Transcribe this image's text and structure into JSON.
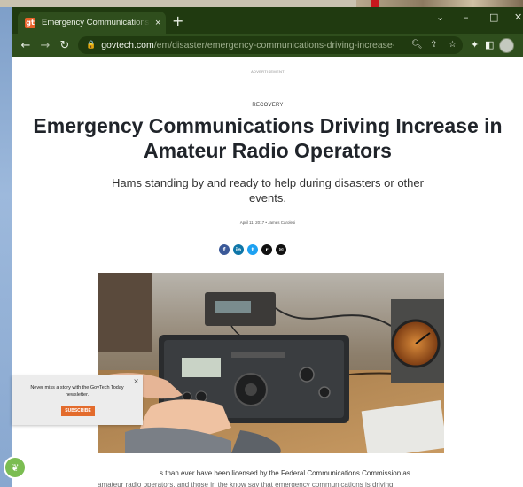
{
  "browser": {
    "tab": {
      "favicon_text": "gt",
      "title": "Emergency Communications Driv",
      "close_glyph": "×"
    },
    "new_tab_glyph": "+",
    "window_controls": {
      "collapse": "⌄",
      "minimize": "–",
      "maximize": "□",
      "close": "✕"
    },
    "nav": {
      "back": "←",
      "forward": "→",
      "reload": "↻"
    },
    "address": {
      "domain": "govtech.com",
      "path": "/em/disaster/emergency-communications-driving-increase-in..."
    }
  },
  "article": {
    "advertisement_label": "ADVERTISEMENT",
    "category": "RECOVERY",
    "headline": "Emergency Communications Driving Increase in Amateur Radio Operators",
    "subheadline": "Hams standing by and ready to help during disasters or other events.",
    "byline": "April 11, 2017 • James Carolesi",
    "share_buttons": [
      {
        "name": "facebook",
        "glyph": "f",
        "color": "#3b5998"
      },
      {
        "name": "linkedin",
        "glyph": "in",
        "color": "#0e76a8"
      },
      {
        "name": "twitter",
        "glyph": "t",
        "color": "#1da1f2"
      },
      {
        "name": "reddit",
        "glyph": "r",
        "color": "#111111"
      },
      {
        "name": "email",
        "glyph": "✉",
        "color": "#111111"
      }
    ],
    "body_line1": "s than ever have been licensed by the Federal Communications Commission as",
    "body_line2": "amateur radio operators, and those in the know say that emergency communications is driving"
  },
  "newsletter_popup": {
    "message": "Never miss a story with the GovTech Today newsletter.",
    "button_label": "SUBSCRIBE",
    "close_glyph": "×"
  },
  "colors": {
    "browser_frame": "#203a10",
    "toolbar": "#2f4e1d",
    "accent": "#e36b2c"
  }
}
